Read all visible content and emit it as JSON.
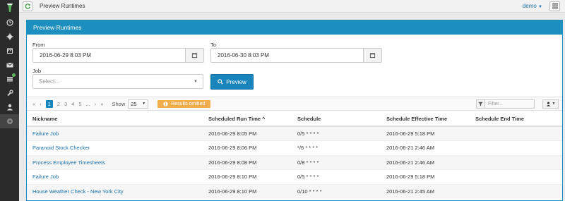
{
  "app": {
    "page_title": "Preview Runtimes",
    "user": "demo"
  },
  "sidebar": {
    "items": [
      {
        "icon": "clock-icon"
      },
      {
        "icon": "gear-icon"
      },
      {
        "icon": "calendar-icon"
      },
      {
        "icon": "envelope-icon"
      },
      {
        "icon": "list-icon"
      },
      {
        "icon": "wrench-icon"
      },
      {
        "icon": "user-icon"
      },
      {
        "icon": "circle-gear-icon"
      }
    ]
  },
  "panel": {
    "title": "Preview Runtimes",
    "from_label": "From",
    "from_value": "2016-06-29 8:03 PM",
    "to_label": "To",
    "to_value": "2016-06-30 8:03 PM",
    "job_label": "Job",
    "job_placeholder": "Select...",
    "preview_label": "Preview"
  },
  "toolbar": {
    "first": "«",
    "prev": "‹",
    "pages": [
      "1",
      "2",
      "3",
      "4",
      "5"
    ],
    "ellipsis": "...",
    "next": "›",
    "last": "»",
    "show_label": "Show",
    "show_value": "25",
    "omitted_label": "Results omitted",
    "filter_placeholder": "Filter..."
  },
  "table": {
    "headers": [
      "Nickname",
      "Scheduled Run Time",
      "Schedule",
      "Schedule Effective Time",
      "Schedule End Time"
    ],
    "rows": [
      [
        "Failure Job",
        "2016-06-29 8:05 PM",
        "0/5 * * * *",
        "2016-06-29 5:18 PM",
        ""
      ],
      [
        "Paranoid Stock Checker",
        "2016-06-29 8:06 PM",
        "*/6 * * * *",
        "2016-06-21 2:46 AM",
        ""
      ],
      [
        "Process Employee Timesheets",
        "2016-06-29 8:08 PM",
        "0/8 * * * *",
        "2016-06-21 2:46 AM",
        ""
      ],
      [
        "Failure Job",
        "2016-06-29 8:10 PM",
        "0/5 * * * *",
        "2016-06-29 5:18 PM",
        ""
      ],
      [
        "House Weather Check - New York City",
        "2016-06-29 8:10 PM",
        "0/10 * * * *",
        "2016-06-21 2:45 AM",
        ""
      ]
    ]
  },
  "colors": {
    "accent": "#1c8fbf",
    "warning": "#f0ad4e",
    "link": "#1a6fa8"
  }
}
